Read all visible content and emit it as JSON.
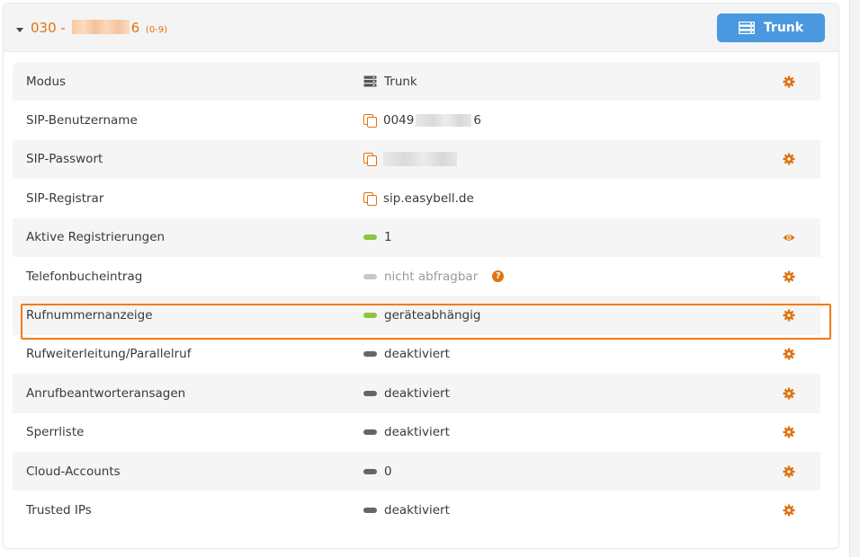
{
  "header": {
    "prefix": "030 -",
    "suffix": "6",
    "range": "(0-9)",
    "mode_button_label": "Trunk"
  },
  "rows": [
    {
      "label": "Modus",
      "value": "Trunk",
      "icon": "server-icon",
      "action": "gear-icon"
    },
    {
      "label": "SIP-Benutzername",
      "value_prefix": "0049",
      "value_suffix": "6",
      "icon": "copy-icon",
      "action": ""
    },
    {
      "label": "SIP-Passwort",
      "value": "",
      "icon": "copy-icon",
      "action": "gear-icon"
    },
    {
      "label": "SIP-Registrar",
      "value": "sip.easybell.de",
      "icon": "copy-icon",
      "action": ""
    },
    {
      "label": "Aktive Registrierungen",
      "value": "1",
      "status": "green",
      "action": "eye-icon"
    },
    {
      "label": "Telefonbucheintrag",
      "value": "nicht abfragbar",
      "status": "gray",
      "help": "?",
      "action": "gear-icon"
    },
    {
      "label": "Rufnummernanzeige",
      "value": "geräteabhängig",
      "status": "green",
      "action": "gear-icon",
      "highlighted": true
    },
    {
      "label": "Rufweiterleitung/Parallelruf",
      "value": "deaktiviert",
      "status": "dark",
      "action": "gear-icon"
    },
    {
      "label": "Anrufbeantworteransagen",
      "value": "deaktiviert",
      "status": "dark",
      "action": "gear-icon"
    },
    {
      "label": "Sperrliste",
      "value": "deaktiviert",
      "status": "dark",
      "action": "gear-icon"
    },
    {
      "label": "Cloud-Accounts",
      "value": "0",
      "status": "dark",
      "action": "gear-icon"
    },
    {
      "label": "Trusted IPs",
      "value": "deaktiviert",
      "status": "dark",
      "action": "gear-icon"
    }
  ],
  "colors": {
    "accent_orange": "#e0730f",
    "button_blue": "#4a98e0",
    "highlight_border": "#f27a12",
    "status_green": "#8cc63f",
    "status_gray": "#c8c8c8",
    "status_dark": "#666666"
  }
}
